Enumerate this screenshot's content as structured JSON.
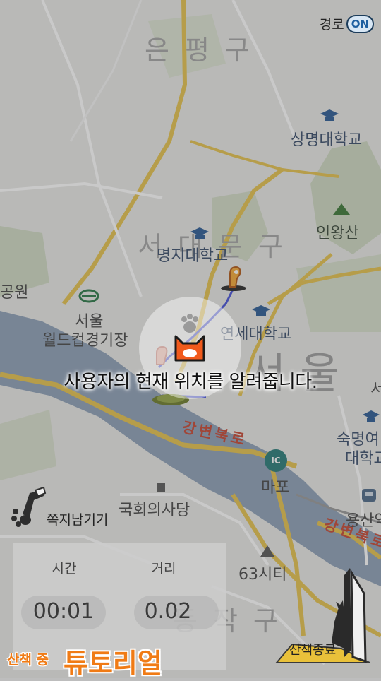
{
  "route_toggle": {
    "label": "경로",
    "state": "ON"
  },
  "map": {
    "districts": [
      "은평구",
      "서대문구",
      "동작구"
    ],
    "places": {
      "sangmyung": "상명대학교",
      "inwangsan": "인왕산",
      "myongji": "명지대학교",
      "park": "공원",
      "stadium_line1": "서울",
      "stadium_line2": "월드컵경기장",
      "yonsei": "연세대학교",
      "seoul_big": "서울",
      "gangbyeon1": "강변북로",
      "gangbyeon2": "강변북로",
      "mapo": "마포",
      "ic": "IC",
      "sookmyung1": "숙명여",
      "sookmyung2": "대학교",
      "national_assembly": "국회의사당",
      "yongsan": "용산역",
      "tower63": "63시티",
      "seo_edge": "서"
    }
  },
  "tutorial": {
    "message": "사용자의 현재 위치를 알려줍니다."
  },
  "note_button": {
    "label": "쪽지남기기"
  },
  "stats": {
    "time_label": "시간",
    "time_value": "00:01",
    "distance_label": "거리",
    "distance_value": "0.02"
  },
  "status": {
    "walking": "산책 중",
    "tutorial": "튜토리얼"
  },
  "end_walk": {
    "label": "산책종료"
  },
  "colors": {
    "accent": "#f07b15",
    "route": "#4a55d8",
    "river": "#8fa1b8"
  }
}
